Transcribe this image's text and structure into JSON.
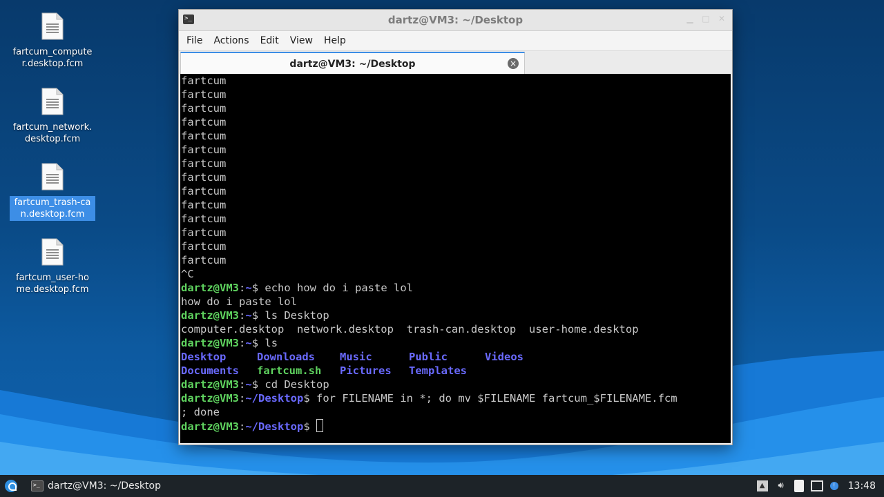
{
  "desktop": {
    "icons": [
      {
        "label": "fartcum_computer.desktop.fcm",
        "selected": false
      },
      {
        "label": "fartcum_network.desktop.fcm",
        "selected": false
      },
      {
        "label": "fartcum_trash-can.desktop.fcm",
        "selected": true
      },
      {
        "label": "fartcum_user-home.desktop.fcm",
        "selected": false
      }
    ]
  },
  "window": {
    "title": "dartz@VM3: ~/Desktop",
    "menu": [
      "File",
      "Actions",
      "Edit",
      "View",
      "Help"
    ],
    "tab_title": "dartz@VM3: ~/Desktop",
    "close_glyph": "×"
  },
  "terminal": {
    "prompt_user": "dartz@VM3",
    "lines": [
      "fartcum",
      "fartcum",
      "fartcum",
      "fartcum",
      "fartcum",
      "fartcum",
      "fartcum",
      "fartcum",
      "fartcum",
      "fartcum",
      "fartcum",
      "fartcum",
      "fartcum",
      "fartcum",
      "^C"
    ],
    "cmd1": "echo how do i paste lol",
    "out1": "how do i paste lol",
    "cmd2": "ls Desktop",
    "out2": "computer.desktop  network.desktop  trash-can.desktop  user-home.desktop",
    "cmd3": "ls",
    "ls_row1": [
      "Desktop",
      "Downloads",
      "Music",
      "Public",
      "Videos"
    ],
    "ls_row2": [
      "Documents",
      "fartcum.sh",
      "Pictures",
      "Templates"
    ],
    "cmd4": "cd Desktop",
    "path_home": "~",
    "path_desktop": "~/Desktop",
    "cmd5": "for FILENAME in *; do mv $FILENAME fartcum_$FILENAME.fcm",
    "cmd5_cont": "; done"
  },
  "taskbar": {
    "task_label": "dartz@VM3: ~/Desktop",
    "clock": "13:48"
  }
}
